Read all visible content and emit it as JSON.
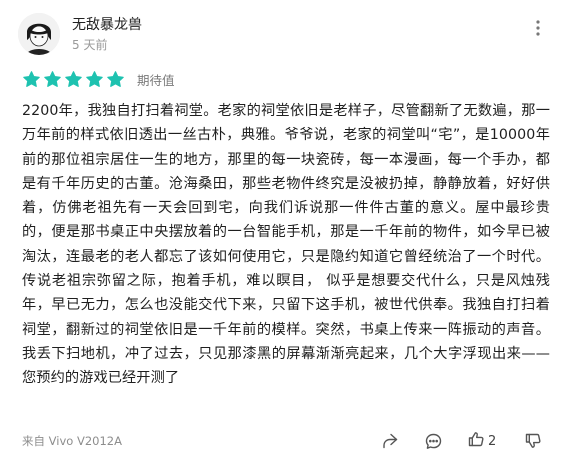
{
  "header": {
    "username": "无敌暴龙兽",
    "time": "5 天前"
  },
  "rating": {
    "stars": 5,
    "max": 5,
    "label": "期待值",
    "star_color": "#1ec2b0"
  },
  "review": {
    "text": "2200年，我独自打扫着祠堂。老家的祠堂依旧是老样子，尽管翻新了无数遍，那一万年前的样式依旧透出一丝古朴，典雅。爷爷说，老家的祠堂叫“宅”，是10000年前的那位祖宗居住一生的地方，那里的每一块瓷砖，每一本漫画，每一个手办，都是有千年历史的古董。沧海桑田，那些老物件终究是没被扔掉，静静放着，好好供着，仿佛老祖先有一天会回到宅，向我们诉说那一件件古董的意义。屋中最珍贵的，便是那书桌正中央摆放着的一台智能手机，那是一千年前的物件，如今早已被淘汰，连最老的老人都忘了该如何使用它，只是隐约知道它曾经统治了一个时代。传说老祖宗弥留之际，抱着手机，难以瞑目， 似乎是想要交代什么，只是风烛残年，早已无力，怎么也没能交代下来，只留下这手机，被世代供奉。我独自打扫着祠堂，翻新过的祠堂依旧是一千年前的模样。突然，书桌上传来一阵振动的声音。我丢下扫地机，冲了过去，只见那漆黑的屏幕渐渐亮起来，几个大字浮现出来——您预约的游戏已经开测了"
  },
  "footer": {
    "device": "来自 Vivo V2012A",
    "like_count": "2"
  },
  "icons": {
    "more": "more-vertical-icon",
    "share": "share-icon",
    "comment": "comment-icon",
    "like": "thumbs-up-icon",
    "dislike": "thumbs-down-icon"
  }
}
